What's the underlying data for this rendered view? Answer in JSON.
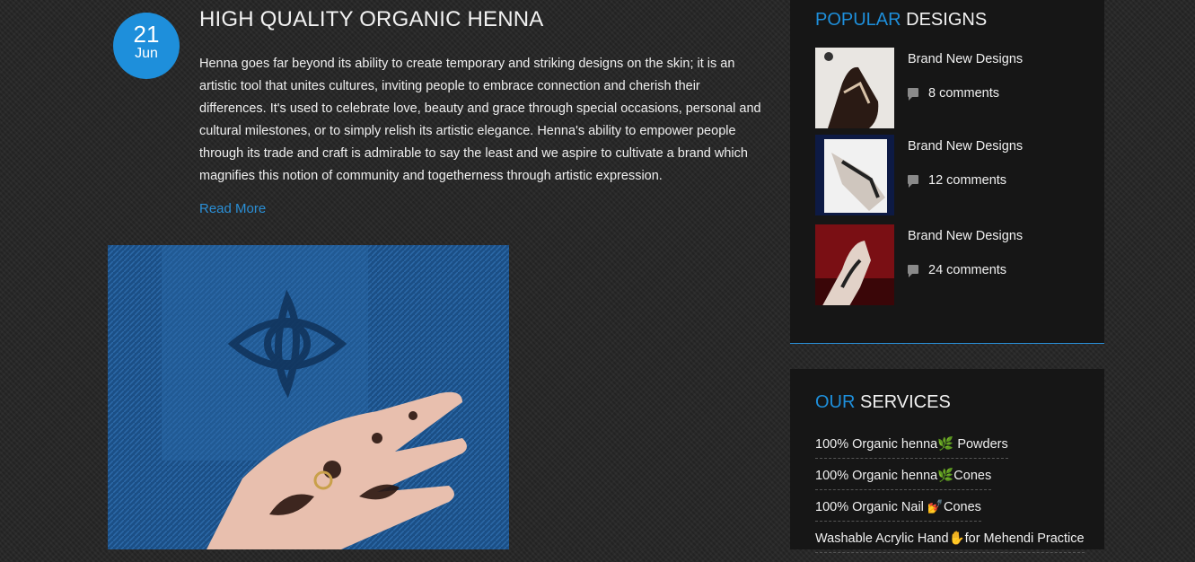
{
  "post": {
    "date_day": "21",
    "date_month": "Jun",
    "title": "HIGH QUALITY ORGANIC HENNA",
    "excerpt": "Henna goes far beyond its ability to create temporary and striking designs on the skin; it is an artistic tool that unites cultures, inviting people to embrace connection and cherish their differences. It's used to celebrate love, beauty and grace through special occasions, personal and cultural milestones, or to simply relish its artistic elegance. Henna's ability to empower people through its trade and craft is admirable to say the least and we aspire to cultivate a brand which magnifies this notion of community and togetherness through artistic expression.",
    "read_more": "Read More"
  },
  "popular": {
    "title_accent": "POPULAR",
    "title_rest": " DESIGNS",
    "items": [
      {
        "title": "Brand New Designs",
        "comments": "8 comments"
      },
      {
        "title": "Brand New Designs",
        "comments": "12 comments"
      },
      {
        "title": "Brand New Designs",
        "comments": "24 comments"
      }
    ]
  },
  "services": {
    "title_accent": "OUR",
    "title_rest": " SERVICES",
    "items": [
      "100% Organic henna🌿 Powders",
      "100% Organic henna🌿Cones",
      "100% Organic Nail 💅Cones",
      "Washable Acrylic Hand✋for Mehendi Practice"
    ]
  },
  "colors": {
    "accent": "#1e8fdb",
    "widget_bg": "#161616"
  }
}
